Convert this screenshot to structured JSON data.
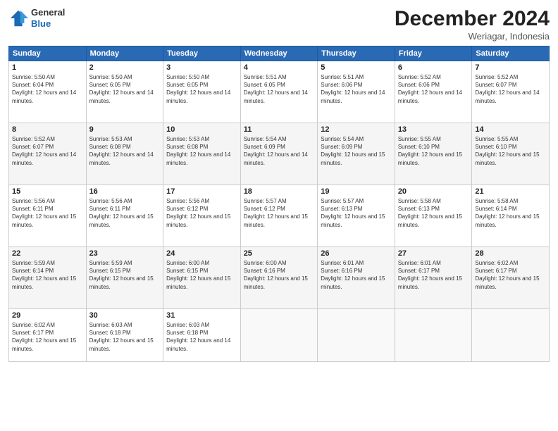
{
  "header": {
    "logo": {
      "general": "General",
      "blue": "Blue"
    },
    "title": "December 2024",
    "location": "Weriagar, Indonesia"
  },
  "weekdays": [
    "Sunday",
    "Monday",
    "Tuesday",
    "Wednesday",
    "Thursday",
    "Friday",
    "Saturday"
  ],
  "weeks": [
    [
      {
        "day": "1",
        "sunrise": "5:50 AM",
        "sunset": "6:04 PM",
        "daylight": "12 hours and 14 minutes."
      },
      {
        "day": "2",
        "sunrise": "5:50 AM",
        "sunset": "6:05 PM",
        "daylight": "12 hours and 14 minutes."
      },
      {
        "day": "3",
        "sunrise": "5:50 AM",
        "sunset": "6:05 PM",
        "daylight": "12 hours and 14 minutes."
      },
      {
        "day": "4",
        "sunrise": "5:51 AM",
        "sunset": "6:05 PM",
        "daylight": "12 hours and 14 minutes."
      },
      {
        "day": "5",
        "sunrise": "5:51 AM",
        "sunset": "6:06 PM",
        "daylight": "12 hours and 14 minutes."
      },
      {
        "day": "6",
        "sunrise": "5:52 AM",
        "sunset": "6:06 PM",
        "daylight": "12 hours and 14 minutes."
      },
      {
        "day": "7",
        "sunrise": "5:52 AM",
        "sunset": "6:07 PM",
        "daylight": "12 hours and 14 minutes."
      }
    ],
    [
      {
        "day": "8",
        "sunrise": "5:52 AM",
        "sunset": "6:07 PM",
        "daylight": "12 hours and 14 minutes."
      },
      {
        "day": "9",
        "sunrise": "5:53 AM",
        "sunset": "6:08 PM",
        "daylight": "12 hours and 14 minutes."
      },
      {
        "day": "10",
        "sunrise": "5:53 AM",
        "sunset": "6:08 PM",
        "daylight": "12 hours and 14 minutes."
      },
      {
        "day": "11",
        "sunrise": "5:54 AM",
        "sunset": "6:09 PM",
        "daylight": "12 hours and 14 minutes."
      },
      {
        "day": "12",
        "sunrise": "5:54 AM",
        "sunset": "6:09 PM",
        "daylight": "12 hours and 15 minutes."
      },
      {
        "day": "13",
        "sunrise": "5:55 AM",
        "sunset": "6:10 PM",
        "daylight": "12 hours and 15 minutes."
      },
      {
        "day": "14",
        "sunrise": "5:55 AM",
        "sunset": "6:10 PM",
        "daylight": "12 hours and 15 minutes."
      }
    ],
    [
      {
        "day": "15",
        "sunrise": "5:56 AM",
        "sunset": "6:11 PM",
        "daylight": "12 hours and 15 minutes."
      },
      {
        "day": "16",
        "sunrise": "5:56 AM",
        "sunset": "6:11 PM",
        "daylight": "12 hours and 15 minutes."
      },
      {
        "day": "17",
        "sunrise": "5:56 AM",
        "sunset": "6:12 PM",
        "daylight": "12 hours and 15 minutes."
      },
      {
        "day": "18",
        "sunrise": "5:57 AM",
        "sunset": "6:12 PM",
        "daylight": "12 hours and 15 minutes."
      },
      {
        "day": "19",
        "sunrise": "5:57 AM",
        "sunset": "6:13 PM",
        "daylight": "12 hours and 15 minutes."
      },
      {
        "day": "20",
        "sunrise": "5:58 AM",
        "sunset": "6:13 PM",
        "daylight": "12 hours and 15 minutes."
      },
      {
        "day": "21",
        "sunrise": "5:58 AM",
        "sunset": "6:14 PM",
        "daylight": "12 hours and 15 minutes."
      }
    ],
    [
      {
        "day": "22",
        "sunrise": "5:59 AM",
        "sunset": "6:14 PM",
        "daylight": "12 hours and 15 minutes."
      },
      {
        "day": "23",
        "sunrise": "5:59 AM",
        "sunset": "6:15 PM",
        "daylight": "12 hours and 15 minutes."
      },
      {
        "day": "24",
        "sunrise": "6:00 AM",
        "sunset": "6:15 PM",
        "daylight": "12 hours and 15 minutes."
      },
      {
        "day": "25",
        "sunrise": "6:00 AM",
        "sunset": "6:16 PM",
        "daylight": "12 hours and 15 minutes."
      },
      {
        "day": "26",
        "sunrise": "6:01 AM",
        "sunset": "6:16 PM",
        "daylight": "12 hours and 15 minutes."
      },
      {
        "day": "27",
        "sunrise": "6:01 AM",
        "sunset": "6:17 PM",
        "daylight": "12 hours and 15 minutes."
      },
      {
        "day": "28",
        "sunrise": "6:02 AM",
        "sunset": "6:17 PM",
        "daylight": "12 hours and 15 minutes."
      }
    ],
    [
      {
        "day": "29",
        "sunrise": "6:02 AM",
        "sunset": "6:17 PM",
        "daylight": "12 hours and 15 minutes."
      },
      {
        "day": "30",
        "sunrise": "6:03 AM",
        "sunset": "6:18 PM",
        "daylight": "12 hours and 15 minutes."
      },
      {
        "day": "31",
        "sunrise": "6:03 AM",
        "sunset": "6:18 PM",
        "daylight": "12 hours and 14 minutes."
      },
      null,
      null,
      null,
      null
    ]
  ]
}
